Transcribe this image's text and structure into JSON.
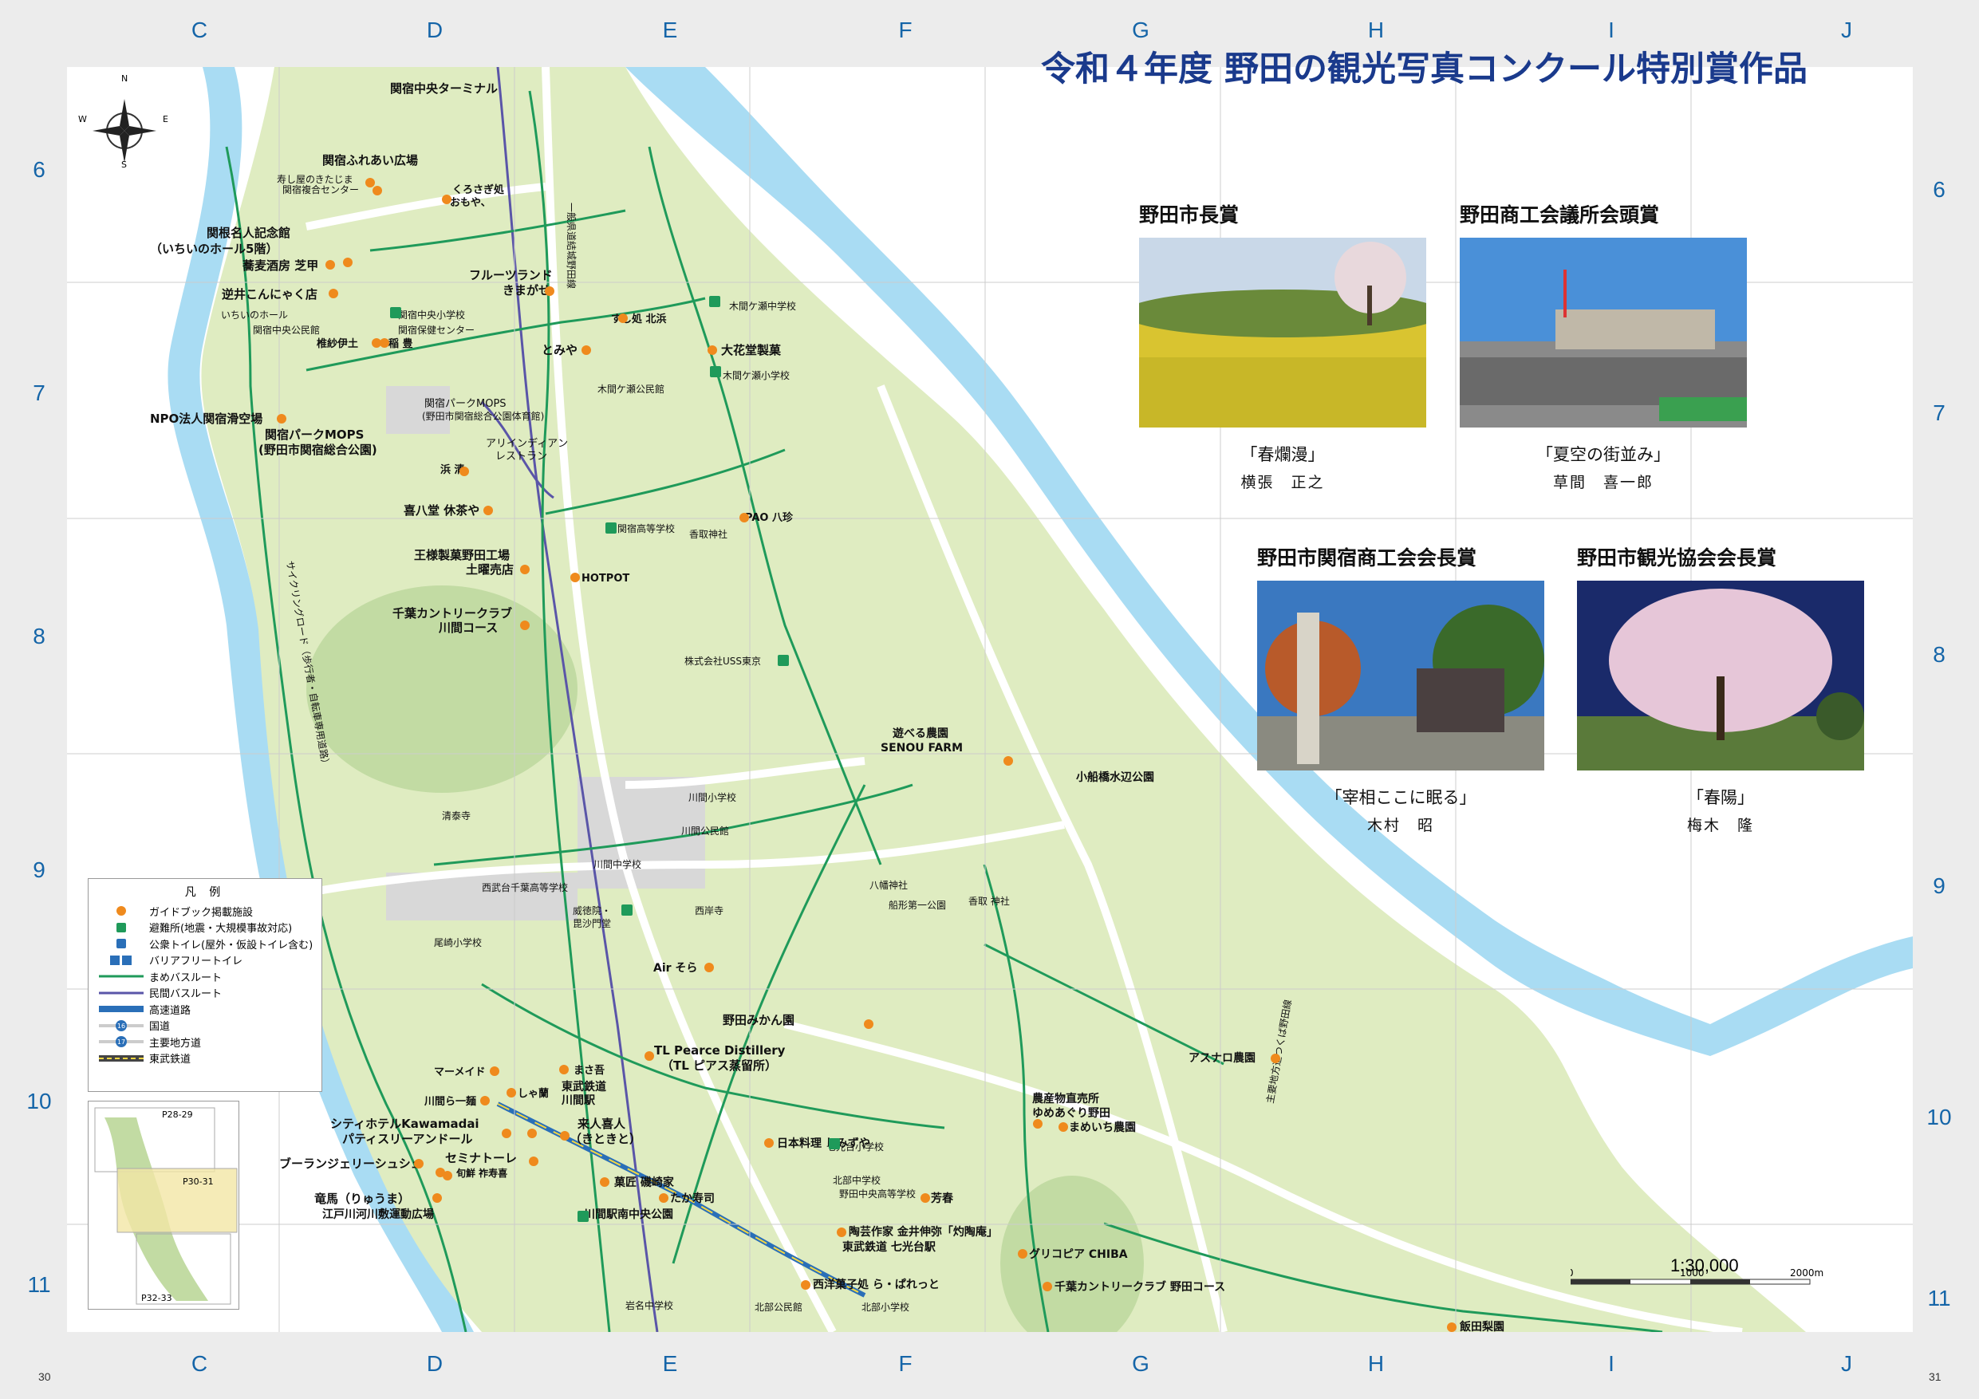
{
  "grid": {
    "columns": [
      "C",
      "D",
      "E",
      "F",
      "G",
      "H",
      "I",
      "J"
    ],
    "rows": [
      "6",
      "7",
      "8",
      "9",
      "10",
      "11"
    ]
  },
  "pages": {
    "left": "30",
    "right": "31"
  },
  "title": "令和４年度 野田の観光写真コンクール特別賞作品",
  "awards": [
    {
      "prize": "野田市長賞",
      "caption": "「春爛漫」",
      "author": "横張　正之"
    },
    {
      "prize": "野田商工会議所会頭賞",
      "caption": "「夏空の街並み」",
      "author": "草間　喜一郎"
    },
    {
      "prize": "野田市関宿商工会会長賞",
      "caption": "「宰相ここに眠る」",
      "author": "木村　昭"
    },
    {
      "prize": "野田市観光協会会長賞",
      "caption": "「春陽」",
      "author": "梅木　隆"
    }
  ],
  "compass": {
    "n": "N",
    "e": "E",
    "s": "S",
    "w": "W"
  },
  "legend": {
    "title": "凡 例",
    "items": [
      "ガイドブック掲載施設",
      "避難所(地震・大規模事故対応)",
      "公衆トイレ(屋外・仮設トイレ含む)",
      "バリアフリートイレ",
      "まめバスルート",
      "民間バスルート",
      "高速道路",
      "国道",
      "主要地方道",
      "東武鉄道"
    ],
    "route_numbers": [
      "16",
      "17"
    ]
  },
  "inset": {
    "pages": [
      "P28-29",
      "P30-31",
      "P32-33"
    ]
  },
  "scale": {
    "ratio": "1:30,000",
    "ticks": [
      "0",
      "1000",
      "2000m"
    ]
  },
  "places": [
    {
      "name": "関宿中央ターミナル"
    },
    {
      "name": "関宿ふれあい広場"
    },
    {
      "name": "寿し屋のきたじま"
    },
    {
      "name": "関宿複合センター"
    },
    {
      "name": "くろさぎ処"
    },
    {
      "name": "おもや、"
    },
    {
      "name": "関根名人記念館"
    },
    {
      "name": "（いちいのホール5階）"
    },
    {
      "name": "蕎麦酒房 芝甲"
    },
    {
      "name": "逆井こんにゃく店"
    },
    {
      "name": "いちいのホール"
    },
    {
      "name": "関宿中央小学校"
    },
    {
      "name": "関宿中央公民館"
    },
    {
      "name": "関宿保健センター"
    },
    {
      "name": "椎紗伊土"
    },
    {
      "name": "稲 豊"
    },
    {
      "name": "フルーツランド"
    },
    {
      "name": "きまがせ"
    },
    {
      "name": "すし処 北浜"
    },
    {
      "name": "とみや"
    },
    {
      "name": "木間ケ瀬中学校"
    },
    {
      "name": "大花堂製菓"
    },
    {
      "name": "木間ケ瀬小学校"
    },
    {
      "name": "NPO法人関宿滑空場"
    },
    {
      "name": "関宿パークMOPS"
    },
    {
      "name": "(野田市関宿総合公園体育館)"
    },
    {
      "name": "関宿パークMOPS"
    },
    {
      "name": "(野田市関宿総合公園)"
    },
    {
      "name": "アリインディアン"
    },
    {
      "name": "レストラン"
    },
    {
      "name": "木間ケ瀬公民館"
    },
    {
      "name": "浜 清"
    },
    {
      "name": "喜八堂 休茶や"
    },
    {
      "name": "PAO 八珍"
    },
    {
      "name": "関宿高等学校"
    },
    {
      "name": "香取神社"
    },
    {
      "name": "王様製菓野田工場"
    },
    {
      "name": "土曜売店"
    },
    {
      "name": "HOTPOT"
    },
    {
      "name": "千葉カントリークラブ"
    },
    {
      "name": "川間コース"
    },
    {
      "name": "株式会社USS東京"
    },
    {
      "name": "遊べる農園"
    },
    {
      "name": "SENOU FARM"
    },
    {
      "name": "小船橋水辺公園"
    },
    {
      "name": "清泰寺"
    },
    {
      "name": "川間小学校"
    },
    {
      "name": "川間公民館"
    },
    {
      "name": "川間中学校"
    },
    {
      "name": "西武台千葉高等学校"
    },
    {
      "name": "西岸寺"
    },
    {
      "name": "威徳院・"
    },
    {
      "name": "毘沙門堂"
    },
    {
      "name": "尾崎小学校"
    },
    {
      "name": "Air そら"
    },
    {
      "name": "八幡神社"
    },
    {
      "name": "船形第一公園"
    },
    {
      "name": "香取 神社"
    },
    {
      "name": "野田みかん園"
    },
    {
      "name": "TL Pearce Distillery"
    },
    {
      "name": "（TL ピアス蒸留所）"
    },
    {
      "name": "マーメイド"
    },
    {
      "name": "まさ吾"
    },
    {
      "name": "しゃ蘭"
    },
    {
      "name": "東武鉄道"
    },
    {
      "name": "川間駅"
    },
    {
      "name": "川間ら一麺"
    },
    {
      "name": "シティホテルKawamadai"
    },
    {
      "name": "パティスリーアンドール"
    },
    {
      "name": "来人喜人"
    },
    {
      "name": "（きときと）"
    },
    {
      "name": "ブーランジェリーシュシュ"
    },
    {
      "name": "セミナトーレ"
    },
    {
      "name": "旬鮮 祚寿喜"
    },
    {
      "name": "竜馬（りゅうま）"
    },
    {
      "name": "江戸川河川敷運動広場"
    },
    {
      "name": "菓匠 磯崎家"
    },
    {
      "name": "たか寿司"
    },
    {
      "name": "川間駅南中央公園"
    },
    {
      "name": "日本料理 しみずや"
    },
    {
      "name": "七光台小学校"
    },
    {
      "name": "北部中学校"
    },
    {
      "name": "野田中央高等学校"
    },
    {
      "name": "陶芸作家 金井伸弥「灼陶庵」"
    },
    {
      "name": "芳春"
    },
    {
      "name": "東武鉄道 七光台駅"
    },
    {
      "name": "西洋菓子処 ら・ぱれっと"
    },
    {
      "name": "北部小学校"
    },
    {
      "name": "北部公民館"
    },
    {
      "name": "岩名中学校"
    },
    {
      "name": "グリコピア CHIBA"
    },
    {
      "name": "千葉カントリークラブ 野田コース"
    },
    {
      "name": "農産物直売所"
    },
    {
      "name": "ゆめあぐり野田"
    },
    {
      "name": "まめいち農園"
    },
    {
      "name": "アスナロ農園"
    },
    {
      "name": "飯田梨園"
    },
    {
      "name": "一般県道結城野田線"
    },
    {
      "name": "サイクリングロード（歩行者・自転車専用道路）"
    },
    {
      "name": "主要地方道つくば野田線"
    }
  ]
}
